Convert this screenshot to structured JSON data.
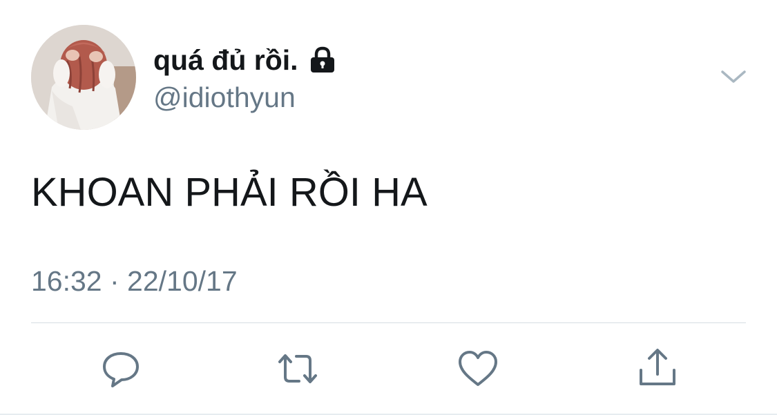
{
  "user": {
    "display_name": "quá đủ rồi.",
    "handle": "@idiothyun",
    "protected": true,
    "avatar": "person-with-hands-on-head"
  },
  "tweet": {
    "text": "KHOAN PHẢI RỒI HA",
    "timestamp": "16:32 · 22/10/17"
  },
  "actions": [
    {
      "name": "reply",
      "icon": "speech-bubble-icon"
    },
    {
      "name": "retweet",
      "icon": "retweet-arrows-icon"
    },
    {
      "name": "like",
      "icon": "heart-icon"
    },
    {
      "name": "share",
      "icon": "share-upload-icon"
    }
  ],
  "colors": {
    "text_primary": "#14171a",
    "text_secondary": "#657786",
    "icon_gray": "#657786",
    "divider": "#d6dde2",
    "background": "#ffffff"
  }
}
